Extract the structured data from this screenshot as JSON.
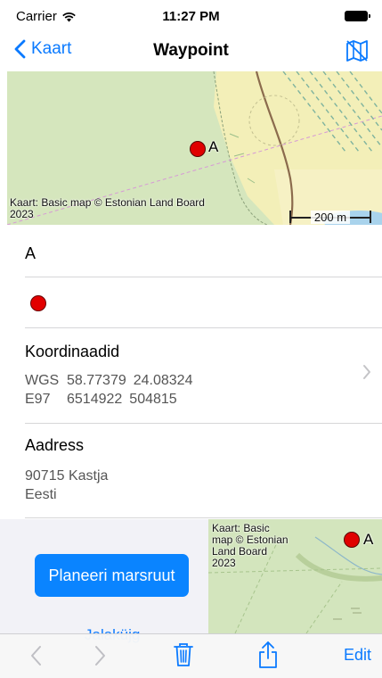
{
  "status_bar": {
    "carrier": "Carrier",
    "time": "11:27 PM"
  },
  "nav": {
    "back_label": "Kaart",
    "title": "Waypoint",
    "map_button_icon": "map-icon"
  },
  "map_top": {
    "attribution": "Kaart: Basic map © Estonian Land Board 2023",
    "scale_label": "200 m",
    "waypoint_label": "A"
  },
  "waypoint": {
    "name": "A",
    "color": "#e20000"
  },
  "coordinates": {
    "header": "Koordinaadid",
    "rows": [
      {
        "system": "WGS",
        "v1": "58.77379",
        "v2": "24.08324"
      },
      {
        "system": "E97",
        "v1": "6514922",
        "v2": "504815"
      }
    ]
  },
  "address": {
    "header": "Aadress",
    "line1": "90715 Kastja",
    "line2": "Eesti"
  },
  "actions": {
    "plan_route_label": "Planeeri marsruut",
    "tracks_label": "Jalaküjg"
  },
  "map_small": {
    "attribution": "Kaart: Basic map © Estonian Land Board 2023",
    "waypoint_label": "A"
  },
  "toolbar": {
    "edit_label": "Edit",
    "back_icon": "chevron-left-icon",
    "forward_icon": "chevron-right-icon",
    "trash_icon": "trash-icon",
    "share_icon": "share-icon"
  },
  "colors": {
    "accent": "#0a7aff",
    "button": "#0a84ff",
    "pin": "#e00000"
  }
}
